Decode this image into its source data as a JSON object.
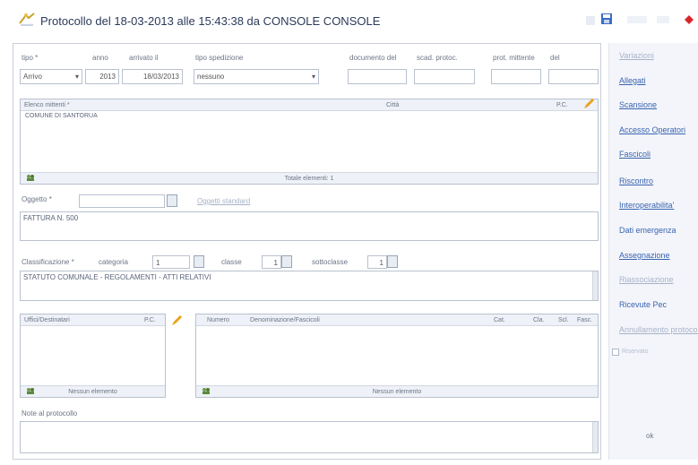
{
  "title": "Protocollo del  18-03-2013  alle  15:43:38  da  CONSOLE CONSOLE",
  "labels": {
    "tipo": "tipo *",
    "anno": "anno",
    "arrivato": "arrivato il",
    "tipo_spedizione": "tipo spedizione",
    "documento_del": "documento del",
    "scad_protoc": "scad. protoc.",
    "prot_mittente": "prot. mittente",
    "del": "del",
    "elenco_mittenti": "Elenco mittenti *",
    "citta": "Città",
    "pc": "P.C.",
    "oggetto": "Oggetto *",
    "oggetti_standard": "Oggetti standard",
    "classificazione": "Classificazione *",
    "categoria": "categoria",
    "classe": "classe",
    "sottoclasse": "sottoclasse",
    "uffici_destinatari": "Uffici/Destinatari",
    "pc2": "P.C.",
    "number_col": "Numero",
    "desc_col": "Denominazione/Fascicoli",
    "col_cat": "Cat.",
    "col_cla": "Cla.",
    "col_scl": "Scl.",
    "col_fasc": "Fasc.",
    "note": "Note al protocollo"
  },
  "fields": {
    "tipo": "Arrivo",
    "anno": "2013",
    "arrivato": "18/03/2013",
    "tipo_spedizione": "nessuno",
    "categoria": "1",
    "classe": "1",
    "sottoclasse": "1"
  },
  "mittenti": [
    "COMUNE DI SANTORUA"
  ],
  "mittenti_footer": "Totale elementi: 1",
  "oggetto_text": "FATTURA N. 500",
  "classificazione_text": "STATUTO COMUNALE - REGOLAMENTI - ATTI RELATIVI",
  "uffici_footer": "Nessun elemento",
  "fascicoli_footer": "Nessun elemento",
  "right_menu": [
    {
      "label": "Variazioni",
      "disabled": true
    },
    {
      "label": "Allegati",
      "disabled": false
    },
    {
      "label": "Scansione",
      "disabled": false
    },
    {
      "label": "Accesso Operatori",
      "disabled": false
    },
    {
      "label": "Fascicoli",
      "disabled": false
    },
    {
      "label": "Riscontro",
      "disabled": false
    },
    {
      "label": "Interoperabilita'",
      "disabled": false
    },
    {
      "label": "Dati emergenza",
      "disabled": false,
      "plain": true
    },
    {
      "label": "Assegnazione",
      "disabled": false
    },
    {
      "label": "Riassociazione",
      "disabled": true
    },
    {
      "label": "Ricevute Pec",
      "disabled": true,
      "plain": true
    },
    {
      "label": "Annullamento protocollo",
      "disabled": true
    }
  ],
  "right_checkbox_label": "Riservato",
  "ok_label": "ok",
  "colors": {
    "accent": "#3a64b0",
    "pencil": "#e8a21c",
    "red": "#d9262e"
  }
}
